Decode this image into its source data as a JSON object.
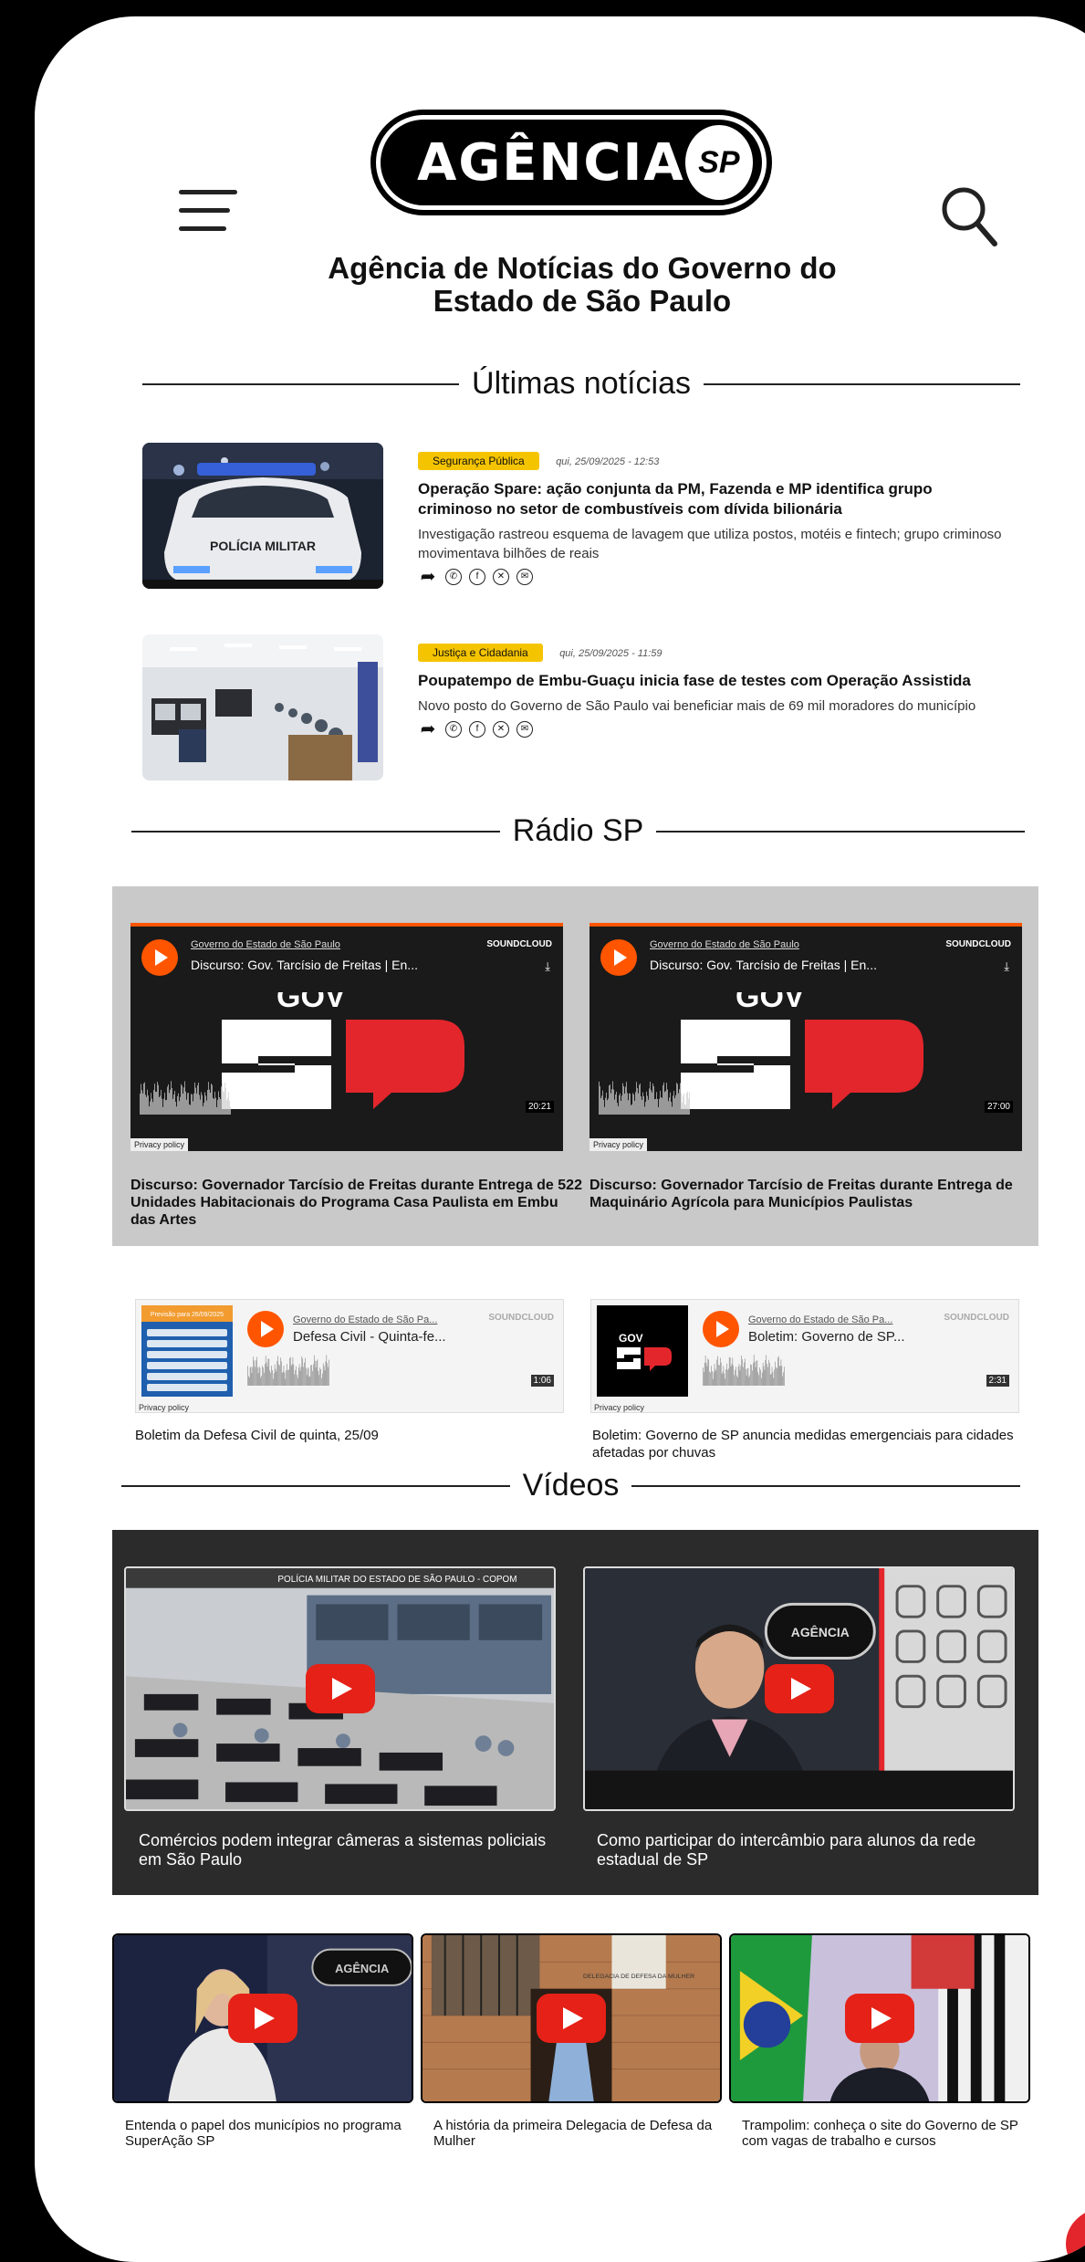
{
  "header": {
    "logo_word": "AGÊNCIA",
    "logo_badge": "SP",
    "site_title": "Agência de Notícias do Governo do Estado de São Paulo"
  },
  "latest": {
    "heading": "Últimas notícias",
    "items": [
      {
        "category": "Segurança Pública",
        "date": "qui, 25/09/2025 - 12:53",
        "title": "Operação Spare: ação conjunta da PM, Fazenda e MP identifica grupo criminoso no setor de combustíveis com dívida bilionária",
        "summary": "Investigação rastreou esquema de lavagem que utiliza postos, motéis e fintech; grupo criminoso movimentava bilhões de reais",
        "thumb_text": "POLÍCIA MILITAR"
      },
      {
        "category": "Justiça e Cidadania",
        "date": "qui, 25/09/2025 - 11:59",
        "title": "Poupatempo de Embu-Guaçu inicia fase de testes com Operação Assistida",
        "summary": "Novo posto do Governo de São Paulo vai beneficiar mais de 69 mil moradores do município"
      }
    ]
  },
  "radio": {
    "heading": "Rádio SP",
    "players": [
      {
        "author": "Governo do Estado de São Paulo",
        "track": "Discurso: Gov. Tarcísio de Freitas | En...",
        "brand": "SOUNDCLOUD",
        "art_text": "GOV",
        "duration": "20:21",
        "privacy": "Privacy policy",
        "caption": "Discurso: Governador Tarcísio de Freitas durante Entrega de 522 Unidades Habitacionais do Programa Casa Paulista em Embu das Artes"
      },
      {
        "author": "Governo do Estado de São Paulo",
        "track": "Discurso: Gov. Tarcísio de Freitas | En...",
        "brand": "SOUNDCLOUD",
        "art_text": "GOV",
        "duration": "27:00",
        "privacy": "Privacy policy",
        "caption": "Discurso: Governador Tarcísio de Freitas durante Entrega de Maquinário Agrícola para Municípios Paulistas"
      }
    ],
    "mini_players": [
      {
        "author": "Governo do Estado de São Pa...",
        "track": "Defesa Civil - Quinta-fe...",
        "brand": "SOUNDCLOUD",
        "art_title": "Previsão para 26/09/2025",
        "duration": "1:06",
        "privacy": "Privacy policy",
        "caption": "Boletim da Defesa Civil de quinta, 25/09"
      },
      {
        "author": "Governo do Estado de São Pa...",
        "track": "Boletim: Governo de SP...",
        "brand": "SOUNDCLOUD",
        "art_gov": "GOV",
        "art_sp": "SP",
        "duration": "2:31",
        "privacy": "Privacy policy",
        "caption": "Boletim: Governo de SP anuncia medidas emergenciais para cidades afetadas por chuvas"
      }
    ]
  },
  "videos": {
    "heading": "Vídeos",
    "featured": [
      {
        "caption": "Comércios podem integrar câmeras a sistemas policiais em São Paulo",
        "banner": "POLÍCIA MILITAR DO ESTADO DE SÃO PAULO - COPOM"
      },
      {
        "caption": "Como participar do intercâmbio para alunos da rede estadual de SP",
        "sign": "AGÊNCIA"
      }
    ],
    "small": [
      {
        "caption": "Entenda o papel dos municípios no programa SuperAção SP",
        "sign": "AGÊNCIA"
      },
      {
        "caption": "A história da primeira Delegacia de Defesa da Mulher",
        "sign": "DELEGACIA DE DEFESA DA MULHER"
      },
      {
        "caption": "Trampolim: conheça o site do Governo de SP com vagas de trabalho e cursos"
      }
    ]
  },
  "colors": {
    "badge_yellow": "#f5c400",
    "soundcloud_orange": "#ff5500",
    "youtube_red": "#e62117",
    "gov_red": "#e3262c"
  }
}
